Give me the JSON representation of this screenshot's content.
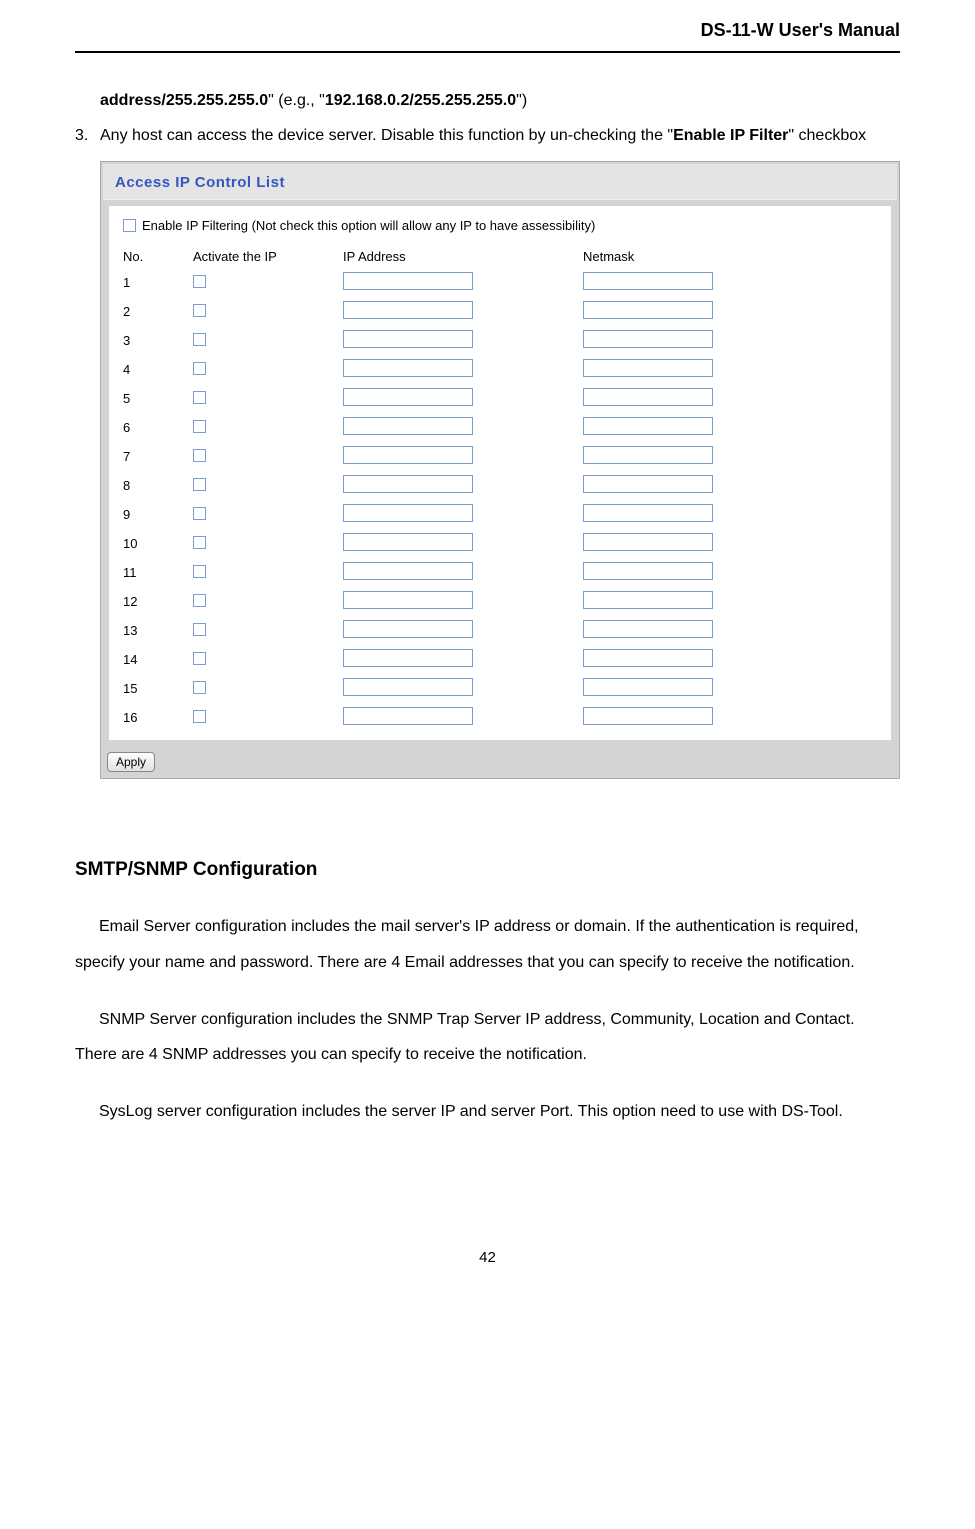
{
  "header": {
    "title": "DS-11-W User's Manual"
  },
  "top_line": {
    "prefix": "address/255.255.255.0",
    "mid": "\" (e.g., \"",
    "example": "192.168.0.2/255.255.255.0",
    "suffix": "\")"
  },
  "list3": {
    "num": "3.",
    "t1": "Any host can access the device server.    Disable this function by un-checking the \"",
    "bold": "Enable IP Filter",
    "t2": "\" checkbox"
  },
  "panel": {
    "title": "Access IP Control List",
    "enable_label": "Enable IP Filtering (Not check this option will allow any IP to have assessibility)",
    "cols": {
      "no": "No.",
      "act": "Activate the IP",
      "ip": "IP Address",
      "net": "Netmask"
    },
    "rows": [
      "1",
      "2",
      "3",
      "4",
      "5",
      "6",
      "7",
      "8",
      "9",
      "10",
      "11",
      "12",
      "13",
      "14",
      "15",
      "16"
    ],
    "apply": "Apply"
  },
  "section_heading": "SMTP/SNMP Configuration",
  "p1": "Email Server configuration includes the mail server's IP address or domain.    If the authentication is required, specify your name and password.    There are 4 Email addresses that you can specify to receive the notification.",
  "p2": "SNMP Server configuration includes the SNMP Trap Server IP address, Community, Location and Contact.    There are 4 SNMP addresses you can specify to receive the notification.",
  "p3": "SysLog server configuration includes the server IP and server Port.    This option need to use with DS-Tool.",
  "page_num": "42"
}
